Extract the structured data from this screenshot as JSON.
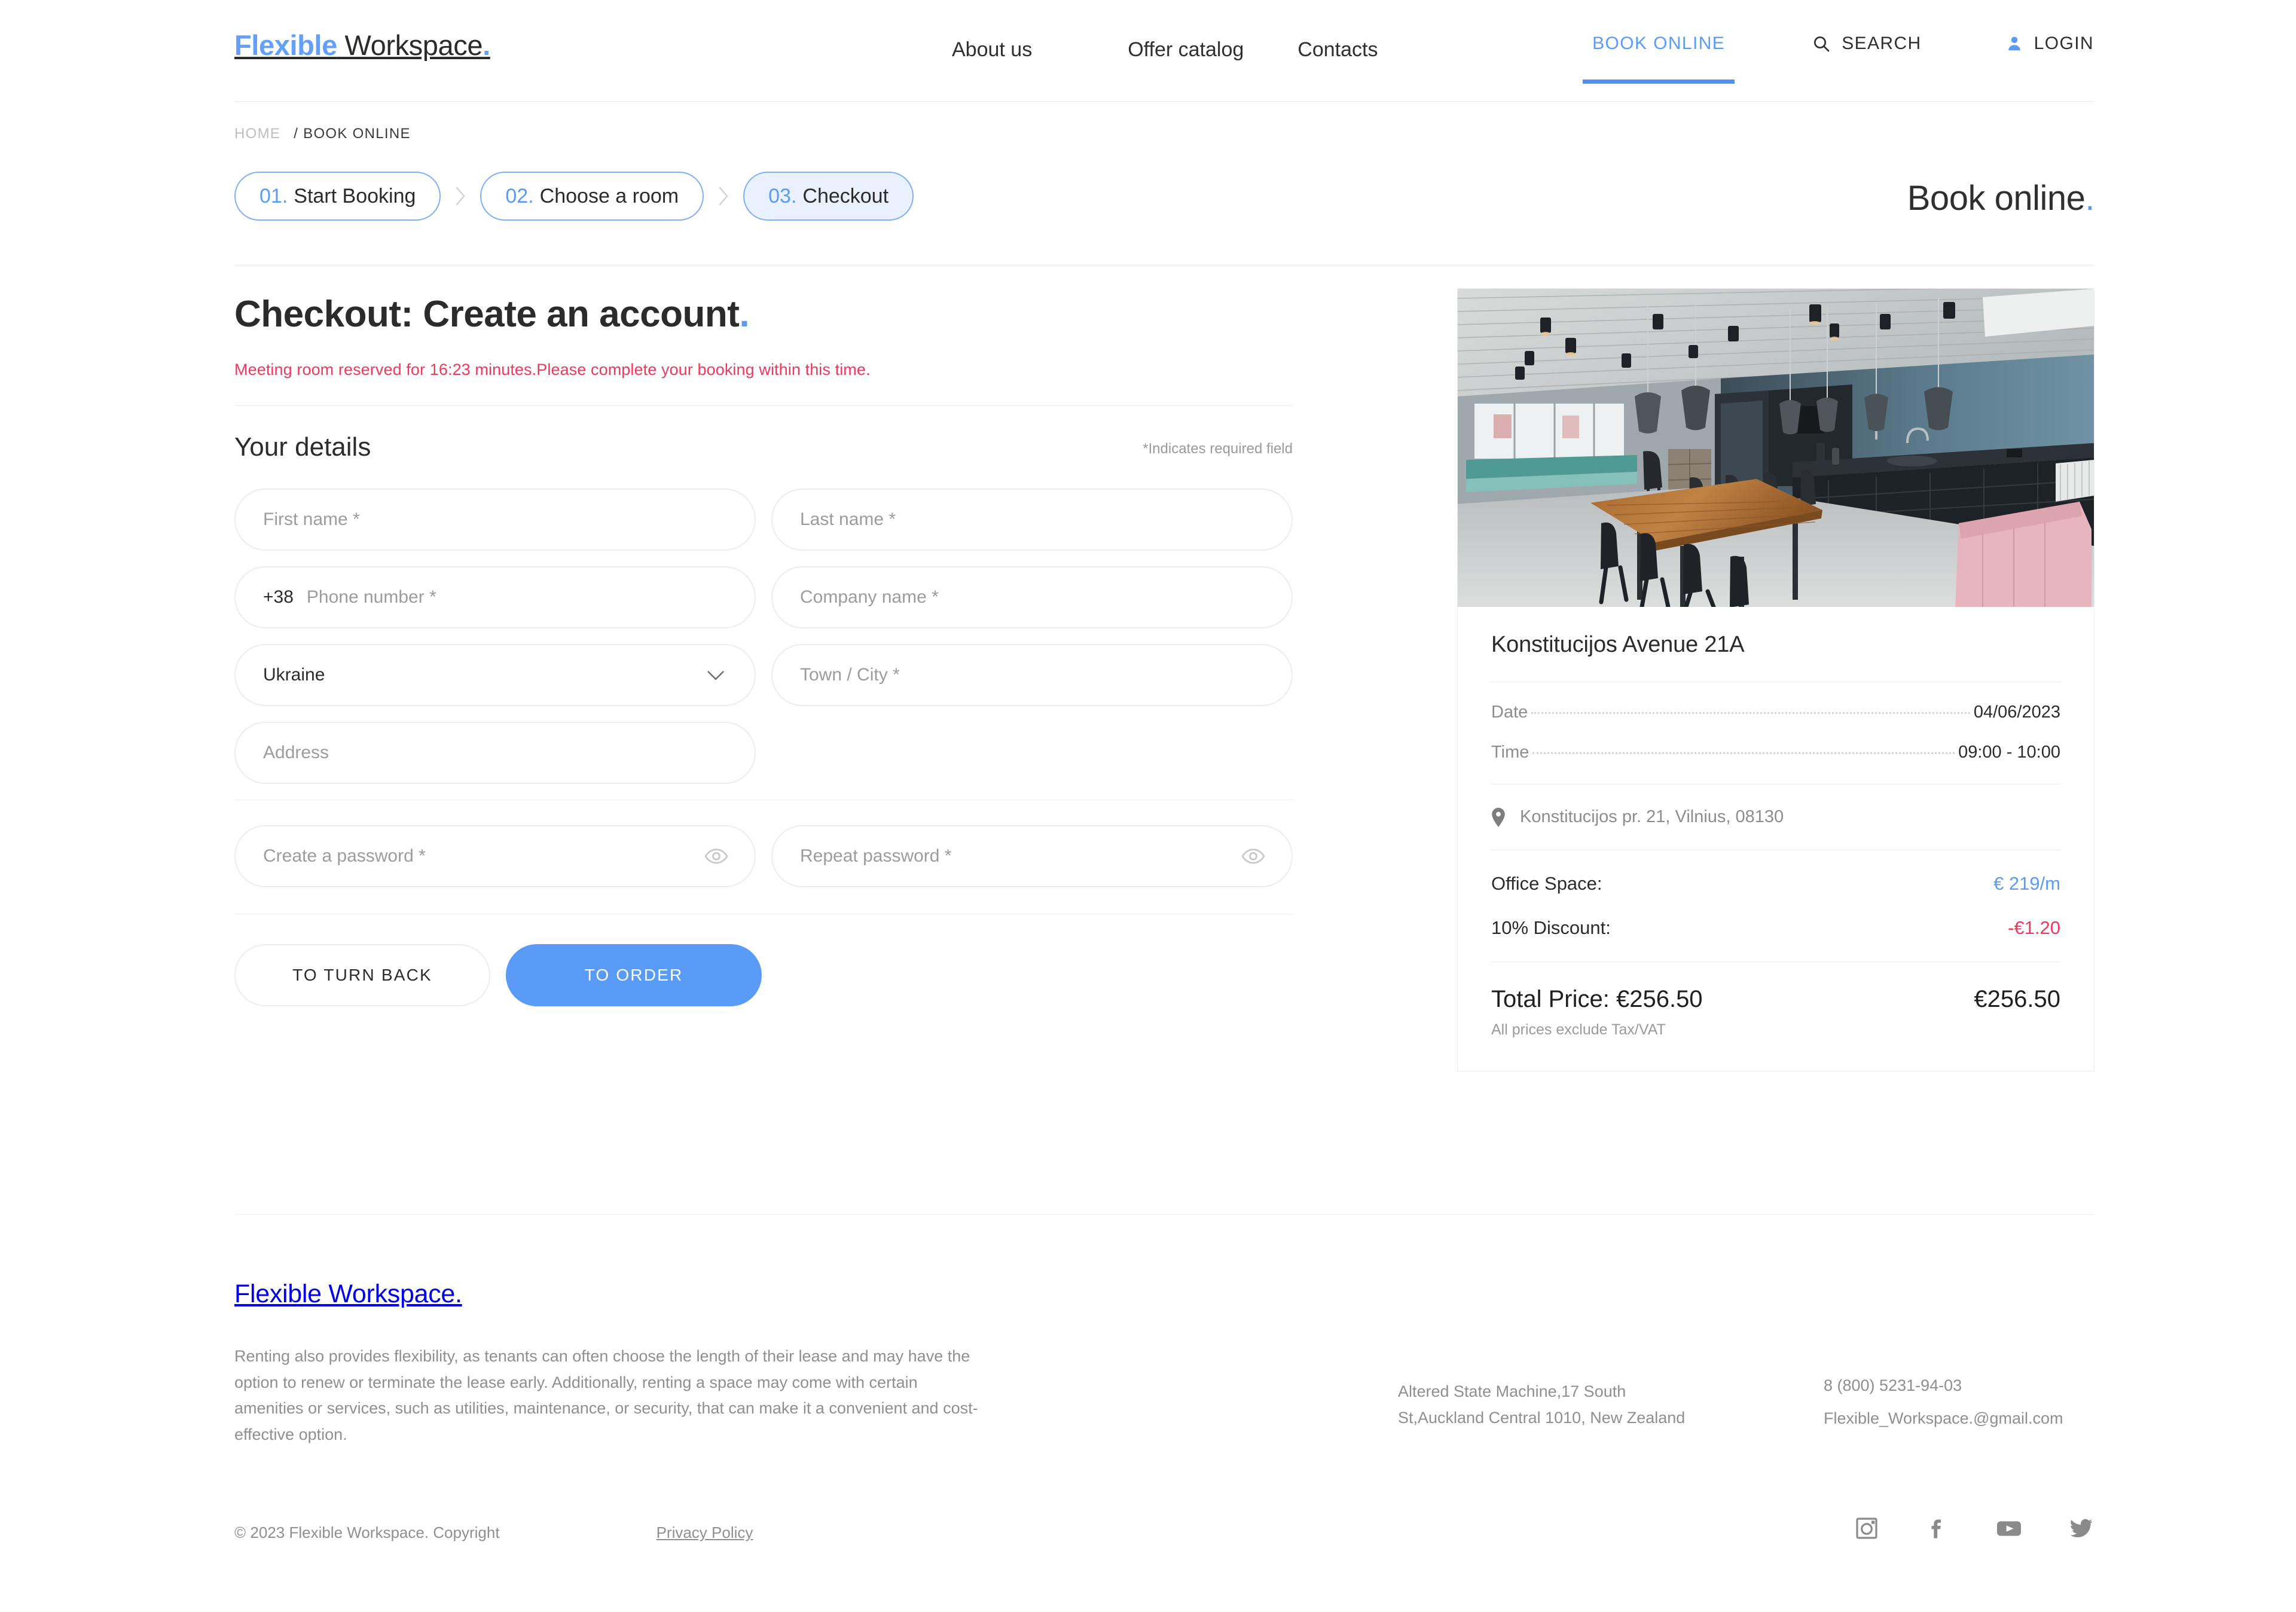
{
  "brand": {
    "accent_word": "Flexible",
    "plain_word": " Workspace",
    "dot": "."
  },
  "header": {
    "nav": [
      {
        "label": "About us"
      },
      {
        "label": "Offer catalog"
      },
      {
        "label": "Contacts"
      }
    ],
    "util": {
      "book_online": "BOOK ONLINE",
      "search": "SEARCH",
      "login": "LOGIN"
    }
  },
  "breadcrumb": {
    "home": "HOME",
    "current": "/ BOOK ONLINE"
  },
  "steps": [
    {
      "num": "01.",
      "label": "Start Booking"
    },
    {
      "num": "02.",
      "label": "Choose a room"
    },
    {
      "num": "03.",
      "label": "Checkout"
    }
  ],
  "page_title": {
    "text": "Book online",
    "dot": "."
  },
  "checkout": {
    "title": "Checkout: Create an account",
    "title_dot": ".",
    "reserve_note": "Meeting room reserved for 16:23 minutes.Please complete your booking within this time.",
    "details_title": "Your details",
    "required_hint": "*Indicates required field"
  },
  "form": {
    "first_name": {
      "placeholder": "First name *"
    },
    "last_name": {
      "placeholder": "Last name *"
    },
    "phone": {
      "prefix": "+38",
      "placeholder": "Phone number *"
    },
    "company": {
      "placeholder": "Company name *"
    },
    "country": {
      "value": "Ukraine"
    },
    "town_city": {
      "placeholder": "Town / City *"
    },
    "address": {
      "placeholder": "Address"
    },
    "password": {
      "placeholder": "Create a password *"
    },
    "repeat_password": {
      "placeholder": "Repeat password *"
    },
    "buttons": {
      "back": "TO TURN BACK",
      "order": "TO ORDER"
    }
  },
  "summary": {
    "room_name": "Konstitucijos Avenue 21A",
    "date_label": "Date",
    "date_value": "04/06/2023",
    "time_label": "Time",
    "time_value": "09:00 - 10:00",
    "address": "Konstitucijos pr. 21, Vilnius, 08130",
    "office_space_label": "Office Space:",
    "office_space_value": "€ 219/m",
    "discount_label": "10% Discount:",
    "discount_value": "-€1.20",
    "total_label": "Total Price: €256.50",
    "total_value": "€256.50",
    "tax_note": "All prices exclude Tax/VAT"
  },
  "footer": {
    "description": "Renting also provides flexibility, as tenants can often choose the length of their lease and may have the option to renew or terminate the lease early. Additionally, renting a space may come with certain amenities or services, such as utilities, maintenance, or security, that can make it a convenient and cost-effective option.",
    "address_line1": "Altered State Machine,17 South",
    "address_line2": "St,Auckland Central 1010, New Zealand",
    "phone": "8 (800) 5231-94-03",
    "email": "Flexible_Workspace.@gmail.com",
    "copyright": "© 2023 Flexible Workspace. Copyright",
    "privacy": "Privacy Policy",
    "social": [
      {
        "name": "instagram"
      },
      {
        "name": "facebook"
      },
      {
        "name": "youtube"
      },
      {
        "name": "twitter"
      }
    ]
  },
  "colors": {
    "accent_blue": "#5b9bf8",
    "alert_red": "#f2385a",
    "text_dark": "#2b2b2b",
    "text_muted": "#8f8f8f"
  }
}
